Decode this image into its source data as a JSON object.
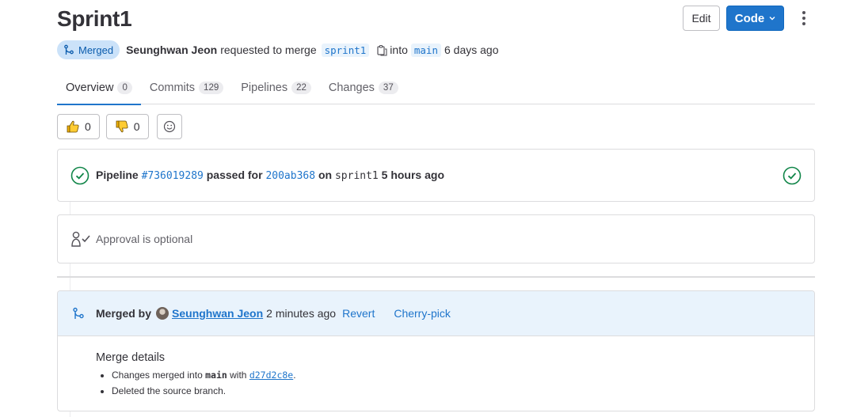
{
  "page": {
    "title": "Sprint1"
  },
  "header": {
    "edit_label": "Edit",
    "code_label": "Code"
  },
  "meta": {
    "status": "Merged",
    "author": "Seunghwan Jeon",
    "requested_text": "requested to merge",
    "source_branch": "sprint1",
    "into_text": "into",
    "target_branch": "main",
    "time": "6 days ago"
  },
  "tabs": [
    {
      "label": "Overview",
      "count": "0"
    },
    {
      "label": "Commits",
      "count": "129"
    },
    {
      "label": "Pipelines",
      "count": "22"
    },
    {
      "label": "Changes",
      "count": "37"
    }
  ],
  "reactions": {
    "thumbs_up": "0",
    "thumbs_down": "0"
  },
  "pipeline": {
    "word": "Pipeline",
    "id": "#736019289",
    "passed_for": "passed for",
    "commit": "200ab368",
    "on": "on",
    "branch": "sprint1",
    "time": "5 hours ago"
  },
  "approval": {
    "text": "Approval is optional"
  },
  "merged": {
    "by_label": "Merged by",
    "user": "Seunghwan Jeon",
    "time": "2 minutes ago",
    "revert": "Revert",
    "cherry_pick": "Cherry-pick",
    "details_title": "Merge details",
    "detail1_prefix": "Changes merged into",
    "detail1_branch": "main",
    "detail1_with": "with",
    "detail1_sha": "d27d2c8e",
    "detail1_suffix": ".",
    "detail2": "Deleted the source branch."
  },
  "colors": {
    "accent": "#1f75cb",
    "success": "#108548",
    "merged_badge_bg": "#cbe2f9"
  }
}
